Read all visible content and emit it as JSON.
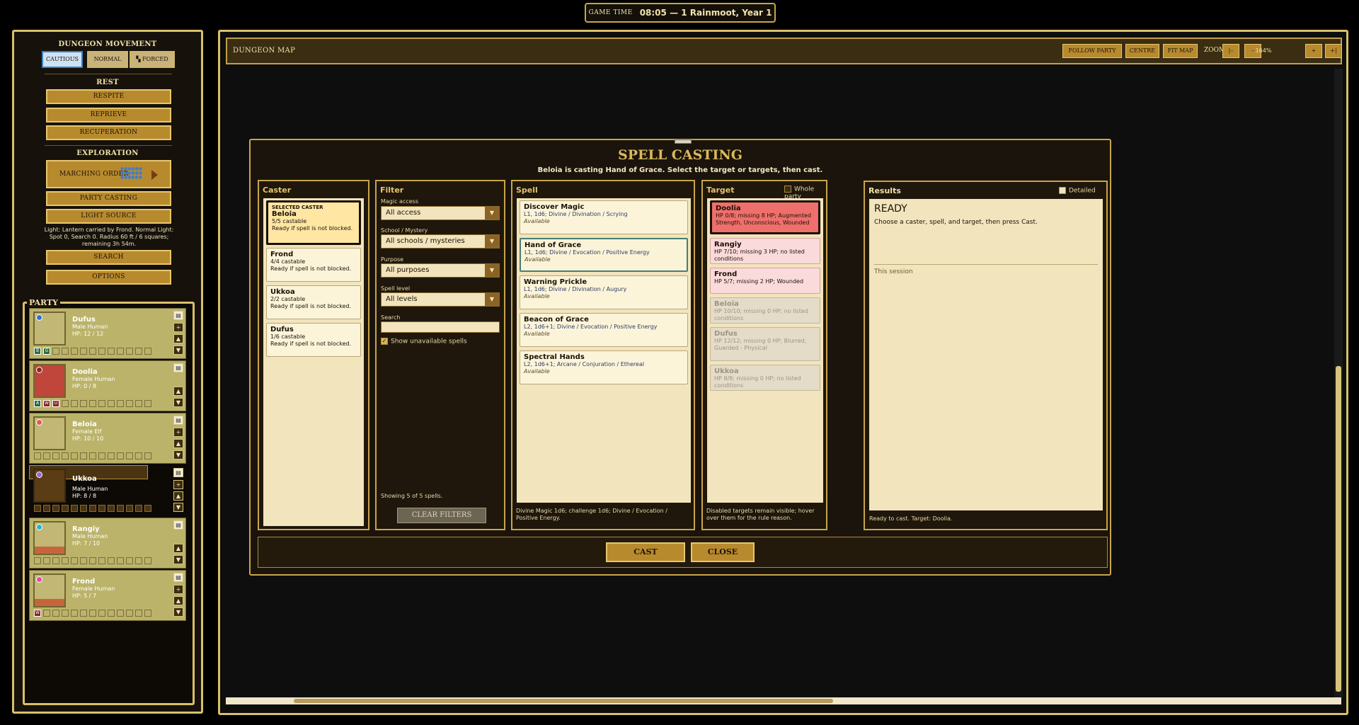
{
  "game_time": {
    "label": "GAME TIME",
    "value": "08:05 — 1 Rainmoot, Year 1"
  },
  "left": {
    "movement": {
      "title": "DUNGEON MOVEMENT",
      "modes": [
        "CAUTIOUS",
        "NORMAL",
        "FORCED"
      ],
      "active": "CAUTIOUS"
    },
    "rest": {
      "title": "REST",
      "buttons": [
        "RESPITE",
        "REPRIEVE",
        "RECUPERATION"
      ]
    },
    "exploration": {
      "title": "EXPLORATION",
      "marching_order": "MARCHING ORDER",
      "party_casting": "PARTY CASTING",
      "light_source": "LIGHT SOURCE"
    },
    "light_info": "Light: Lantern carried by Frond. Normal Light: Spot 0, Search 0. Radius 60 ft / 6 squares; remaining 3h 54m.",
    "search": "SEARCH",
    "options": "OPTIONS"
  },
  "party": {
    "title": "PARTY",
    "members": [
      {
        "name": "Dufus",
        "sex": "Male",
        "race": "Human",
        "hp": "HP:  12 / 12",
        "dot": "#2f6fd6",
        "portrait": "#c2b774",
        "conditions": [
          "B",
          "G"
        ],
        "cond_colors": [
          "#2d6b3a",
          "#2d6b3a"
        ]
      },
      {
        "name": "Doolia",
        "sex": "Female",
        "race": "Human",
        "hp": "HP:  0 / 8",
        "dot": "#8b2a20",
        "portrait": "#c0453a",
        "conditions": [
          "A",
          "W",
          "U"
        ],
        "cond_colors": [
          "#2d6b3a",
          "#8c2525",
          "#8c2525"
        ]
      },
      {
        "name": "Beloia",
        "sex": "Female",
        "race": "Elf",
        "hp": "HP:  10 / 10",
        "dot": "#e05a52",
        "portrait": "#c2b774",
        "conditions": [],
        "cond_colors": []
      },
      {
        "name": "Ukkoa",
        "sex": "Male",
        "race": "Human",
        "hp": "HP:  8 / 8",
        "dot": "#a062d0",
        "portrait": "#5a3d14",
        "conditions": [],
        "cond_colors": []
      },
      {
        "name": "Rangiy",
        "sex": "Male",
        "race": "Human",
        "hp": "HP:  7 / 10",
        "dot": "#1eb4d6",
        "portrait": "#c2b774",
        "conditions": [],
        "cond_colors": []
      },
      {
        "name": "Frond",
        "sex": "Female",
        "race": "Human",
        "hp": "HP:  5 / 7",
        "dot": "#e04aa0",
        "portrait": "#c2b774",
        "conditions": [
          "W"
        ],
        "cond_colors": [
          "#8c2525"
        ]
      }
    ]
  },
  "map": {
    "title": "DUNGEON MAP",
    "buttons": [
      "FOLLOW PARTY",
      "CENTRE",
      "FIT MAP"
    ],
    "zoom_label": "ZOOM",
    "zoom_value": "164%",
    "zoom_controls": [
      "|–",
      "–",
      "+",
      "+|"
    ]
  },
  "modal": {
    "title": "SPELL CASTING",
    "subtitle": "Beloia is casting Hand of Grace. Select the target or targets, then cast.",
    "caster": {
      "header": "Caster",
      "selected_tag": "SELECTED CASTER",
      "items": [
        {
          "name": "Beloia",
          "castable": "5/5 castable",
          "status": "Ready if spell is not blocked."
        },
        {
          "name": "Frond",
          "castable": "4/4 castable",
          "status": "Ready if spell is not blocked."
        },
        {
          "name": "Ukkoa",
          "castable": "2/2 castable",
          "status": "Ready if spell is not blocked."
        },
        {
          "name": "Dufus",
          "castable": "1/6 castable",
          "status": "Ready if spell is not blocked."
        }
      ]
    },
    "filter": {
      "header": "Filter",
      "magic_access_label": "Magic access",
      "magic_access": "All access",
      "school_label": "School / Mystery",
      "school": "All schools / mysteries",
      "purpose_label": "Purpose",
      "purpose": "All purposes",
      "level_label": "Spell level",
      "level": "All levels",
      "search_label": "Search",
      "search_value": "",
      "show_unavailable": "Show unavailable spells",
      "showing": "Showing 5 of 5 spells.",
      "clear": "CLEAR FILTERS"
    },
    "spell": {
      "header": "Spell",
      "items": [
        {
          "name": "Discover Magic",
          "detail": "L1, 1d6; Divine / Divination / Scrying",
          "avail": "Available"
        },
        {
          "name": "Hand of Grace",
          "detail": "L1, 1d6; Divine / Evocation / Positive Energy",
          "avail": "Available"
        },
        {
          "name": "Warning Prickle",
          "detail": "L1, 1d6; Divine / Divination / Augury",
          "avail": "Available"
        },
        {
          "name": "Beacon of Grace",
          "detail": "L2, 1d6+1; Divine / Evocation / Positive Energy",
          "avail": "Available"
        },
        {
          "name": "Spectral Hands",
          "detail": "L2, 1d6+1; Arcane / Conjuration / Ethereal",
          "avail": "Available"
        }
      ],
      "footer": "Divine Magic 1d6; challenge 1d6; Divine / Evocation / Positive Energy."
    },
    "target": {
      "header": "Target",
      "whole_party": "Whole party",
      "items": [
        {
          "name": "Doolia",
          "detail": "HP 0/8; missing 8 HP; Augmented Strength, Unconscious, Wounded"
        },
        {
          "name": "Rangiy",
          "detail": "HP 7/10; missing 3 HP; no listed conditions"
        },
        {
          "name": "Frond",
          "detail": "HP 5/7; missing 2 HP; Wounded"
        },
        {
          "name": "Beloia",
          "detail": "HP 10/10; missing 0 HP; no listed conditions"
        },
        {
          "name": "Dufus",
          "detail": "HP 12/12; missing 0 HP; Blurred, Guarded - Physical"
        },
        {
          "name": "Ukkoa",
          "detail": "HP 8/8; missing 0 HP; no listed conditions"
        }
      ],
      "footer": "Disabled targets remain visible; hover over them for the rule reason."
    },
    "results": {
      "header": "Results",
      "detailed": "Detailed",
      "status": "READY",
      "message": "Choose a caster, spell, and target, then press Cast.",
      "session": "This session",
      "footer": "Ready to cast. Target: Doolia."
    },
    "cast": "CAST",
    "close": "CLOSE"
  }
}
